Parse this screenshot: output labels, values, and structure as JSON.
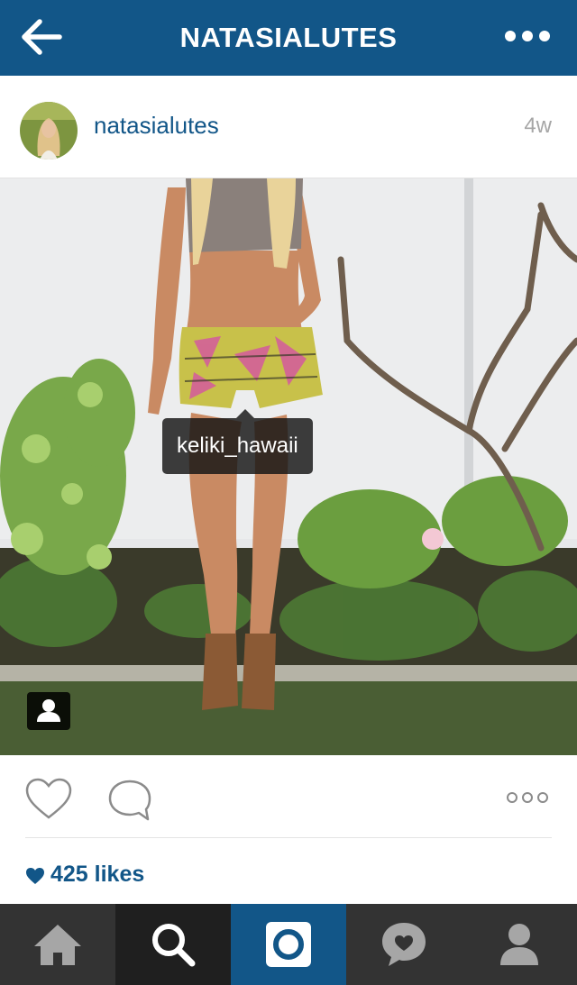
{
  "topbar": {
    "title": "NATASIALUTES",
    "back_icon": "arrow-left-icon",
    "more_icon": "more-horizontal-icon"
  },
  "post": {
    "username": "natasialutes",
    "timestamp": "4w",
    "tagged_user": "keliki_hawaii",
    "likes_text": "425 likes"
  },
  "tabbar": {
    "items": [
      "home-icon",
      "explore-icon",
      "camera-icon",
      "activity-icon",
      "profile-icon"
    ],
    "active": "explore"
  },
  "colors": {
    "brand": "#125688",
    "tabbar": "#333333",
    "tab_active": "#1f1f1f",
    "timestamp": "#a6a6a6"
  }
}
